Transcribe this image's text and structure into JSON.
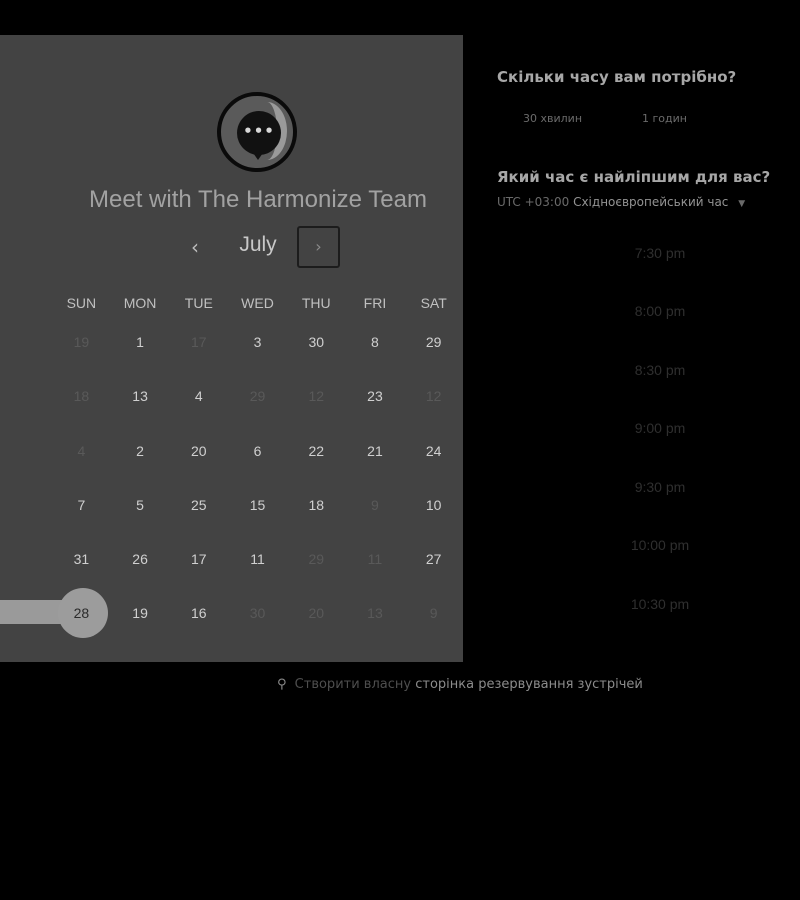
{
  "host": {
    "title": "Meet with The Harmonize Team",
    "logo_icon": "chat-bubble-icon"
  },
  "calendar": {
    "month": "July",
    "prev_icon": "‹",
    "next_icon": "›",
    "weekdays": [
      "SUN",
      "MON",
      "TUE",
      "WED",
      "THU",
      "FRI",
      "SAT"
    ],
    "weeks": [
      [
        {
          "d": "19",
          "a": false
        },
        {
          "d": "1",
          "a": true
        },
        {
          "d": "17",
          "a": false
        },
        {
          "d": "3",
          "a": true
        },
        {
          "d": "30",
          "a": true
        },
        {
          "d": "8",
          "a": true
        },
        {
          "d": "29",
          "a": true
        }
      ],
      [
        {
          "d": "18",
          "a": false
        },
        {
          "d": "13",
          "a": true
        },
        {
          "d": "4",
          "a": true
        },
        {
          "d": "29",
          "a": false
        },
        {
          "d": "12",
          "a": false
        },
        {
          "d": "23",
          "a": true
        },
        {
          "d": "12",
          "a": false
        }
      ],
      [
        {
          "d": "4",
          "a": false
        },
        {
          "d": "2",
          "a": true
        },
        {
          "d": "20",
          "a": true
        },
        {
          "d": "6",
          "a": true
        },
        {
          "d": "22",
          "a": true
        },
        {
          "d": "21",
          "a": true
        },
        {
          "d": "24",
          "a": true
        }
      ],
      [
        {
          "d": "7",
          "a": true
        },
        {
          "d": "5",
          "a": true
        },
        {
          "d": "25",
          "a": true
        },
        {
          "d": "15",
          "a": true
        },
        {
          "d": "18",
          "a": true
        },
        {
          "d": "9",
          "a": false
        },
        {
          "d": "10",
          "a": true
        }
      ],
      [
        {
          "d": "31",
          "a": true
        },
        {
          "d": "26",
          "a": true
        },
        {
          "d": "17",
          "a": true
        },
        {
          "d": "11",
          "a": true
        },
        {
          "d": "29",
          "a": false
        },
        {
          "d": "11",
          "a": false
        },
        {
          "d": "27",
          "a": true
        }
      ],
      [
        {
          "d": "28",
          "a": true,
          "selected": true
        },
        {
          "d": "19",
          "a": true
        },
        {
          "d": "16",
          "a": true
        },
        {
          "d": "30",
          "a": false
        },
        {
          "d": "20",
          "a": false
        },
        {
          "d": "13",
          "a": false
        },
        {
          "d": "9",
          "a": false
        }
      ]
    ]
  },
  "duration": {
    "heading": "Скільки часу вам потрібно?",
    "options": [
      "30 хвилин",
      "1 годин"
    ]
  },
  "time": {
    "heading": "Який час є найліпшим для вас?",
    "tz_offset": "UTC +03:00",
    "tz_name": "Східноєвропейський час",
    "tz_caret": "▼",
    "slots": [
      "7:30 pm",
      "8:00 pm",
      "8:30 pm",
      "9:00 pm",
      "9:30 pm",
      "10:00 pm",
      "10:30 pm"
    ]
  },
  "footer": {
    "icon": "hubspot-sprocket-icon",
    "plain_text": "Створити власну",
    "link_text": "сторінка резервування зустрічей"
  },
  "colors": {
    "page_bg": "#000000",
    "panel_bg": "#434343",
    "selected_day": "#9c9c9c"
  }
}
